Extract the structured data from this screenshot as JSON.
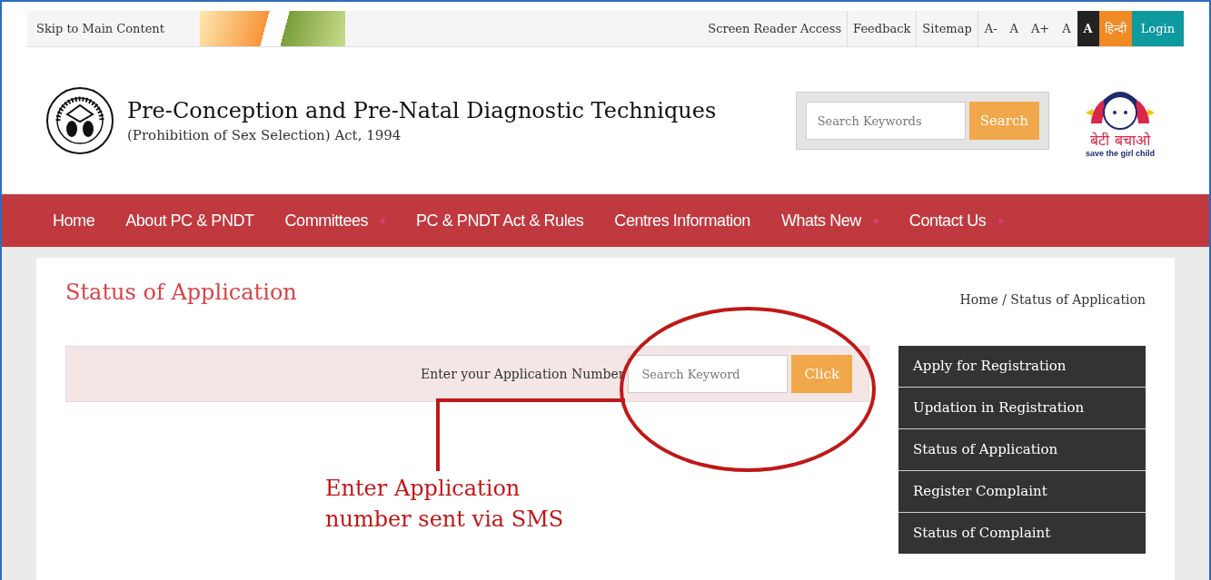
{
  "top_bar": {
    "skip_link": "Skip to Main Content",
    "links": [
      "Screen Reader Access",
      "Feedback",
      "Sitemap"
    ],
    "font_sizes": [
      "A-",
      "A",
      "A+"
    ],
    "contrast": [
      {
        "label": "A",
        "selected": false
      },
      {
        "label": "A",
        "selected": true
      }
    ],
    "language": "हिन्दी",
    "login": "Login"
  },
  "header": {
    "title": "Pre-Conception and Pre-Natal Diagnostic Techniques",
    "subtitle": "(Prohibition of Sex Selection) Act, 1994",
    "search": {
      "placeholder": "Search Keywords",
      "button": "Search"
    },
    "campaign_logo": {
      "hindi": "बेटी बचाओ",
      "english": "save the girl child"
    }
  },
  "nav": [
    {
      "label": "Home",
      "has_submenu": false
    },
    {
      "label": "About PC & PNDT",
      "has_submenu": false
    },
    {
      "label": "Committees",
      "has_submenu": true
    },
    {
      "label": "PC & PNDT Act & Rules",
      "has_submenu": false
    },
    {
      "label": "Centres Information",
      "has_submenu": false
    },
    {
      "label": "Whats New",
      "has_submenu": true
    },
    {
      "label": "Contact Us",
      "has_submenu": true
    }
  ],
  "page": {
    "title": "Status of Application",
    "breadcrumb": "Home / Status of Application",
    "form": {
      "label": "Enter your Application Number",
      "placeholder": "Search Keyword",
      "button": "Click"
    },
    "annotation": "Enter Application number sent via SMS"
  },
  "sidebar": {
    "items": [
      "Apply for Registration",
      "Updation in Registration",
      "Status of Application",
      "Register Complaint",
      "Status of Complaint"
    ]
  }
}
